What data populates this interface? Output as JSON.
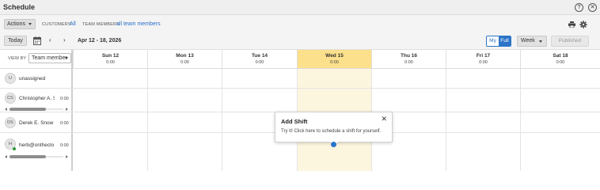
{
  "window": {
    "title": "Schedule",
    "help_icon": "help-icon",
    "close_icon": "close-icon"
  },
  "toolbar": {
    "actions_label": "Actions",
    "customers_label": "CUSTOMERS",
    "customers_value": "All",
    "team_members_label": "TEAM MEMBERS",
    "team_members_value": "all team members",
    "print_icon": "print-icon",
    "settings_icon": "gear-icon"
  },
  "navigation": {
    "today_label": "Today",
    "calendar_icon": "calendar-icon",
    "prev_icon": "chevron-left-icon",
    "next_icon": "chevron-right-icon",
    "date_range": "Apr 12 - 18, 2026",
    "my_label": "My",
    "full_label": "Full",
    "view_label": "Week",
    "published_label": "Published"
  },
  "grid": {
    "view_by_label": "VIEW BY",
    "view_by_value": "Team member",
    "days": [
      {
        "name": "Sun 12",
        "hours": "0:00"
      },
      {
        "name": "Mon 13",
        "hours": "0:00"
      },
      {
        "name": "Tue 14",
        "hours": "0:00"
      },
      {
        "name": "Wed 15",
        "hours": "0:00"
      },
      {
        "name": "Thu 16",
        "hours": "0:00"
      },
      {
        "name": "Fri 17",
        "hours": "0:00"
      },
      {
        "name": "Sat 18",
        "hours": "0:00"
      }
    ],
    "members": [
      {
        "initials": "U",
        "name": "unassigned",
        "hours": ""
      },
      {
        "initials": "CS",
        "name": "Christopher A. S",
        "hours": "0:00"
      },
      {
        "initials": "DS",
        "name": "Derek E. Snow",
        "hours": "0:00"
      },
      {
        "initials": "H",
        "name": "herb@ontheclo",
        "hours": "0:00"
      }
    ]
  },
  "popover": {
    "title": "Add Shift",
    "body": "Try it! Click here to schedule a shift for yourself.",
    "close_symbol": "✕"
  },
  "colors": {
    "accent": "#2b74c7",
    "today_header": "#fde08b",
    "today_column": "#fdf6df",
    "online": "#2e9a3e"
  }
}
